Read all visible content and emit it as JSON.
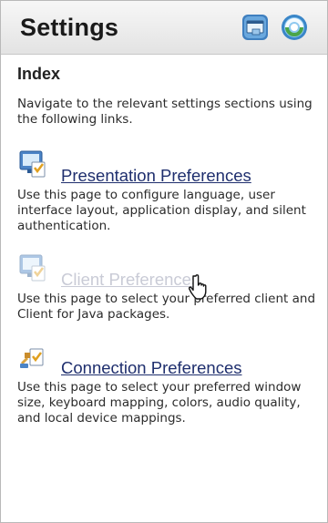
{
  "header": {
    "title": "Settings"
  },
  "index": {
    "title": "Index",
    "intro": "Navigate to the relevant settings sections using the following links."
  },
  "sections": [
    {
      "label": "Presentation Preferences",
      "description": "Use this page to configure language, user interface layout, application display, and silent authentication.",
      "state": "normal"
    },
    {
      "label": "Client Preferences",
      "description": "Use this page to select your preferred client and Client for Java packages.",
      "state": "dimmed"
    },
    {
      "label": "Connection Preferences",
      "description": "Use this page to select your preferred window size, keyboard mapping, colors, audio quality, and local device mappings.",
      "state": "normal"
    }
  ],
  "colors": {
    "link": "#1f2f6e",
    "dimmed_link": "#c9cbd6",
    "header_bg": "#e8e8e8"
  }
}
